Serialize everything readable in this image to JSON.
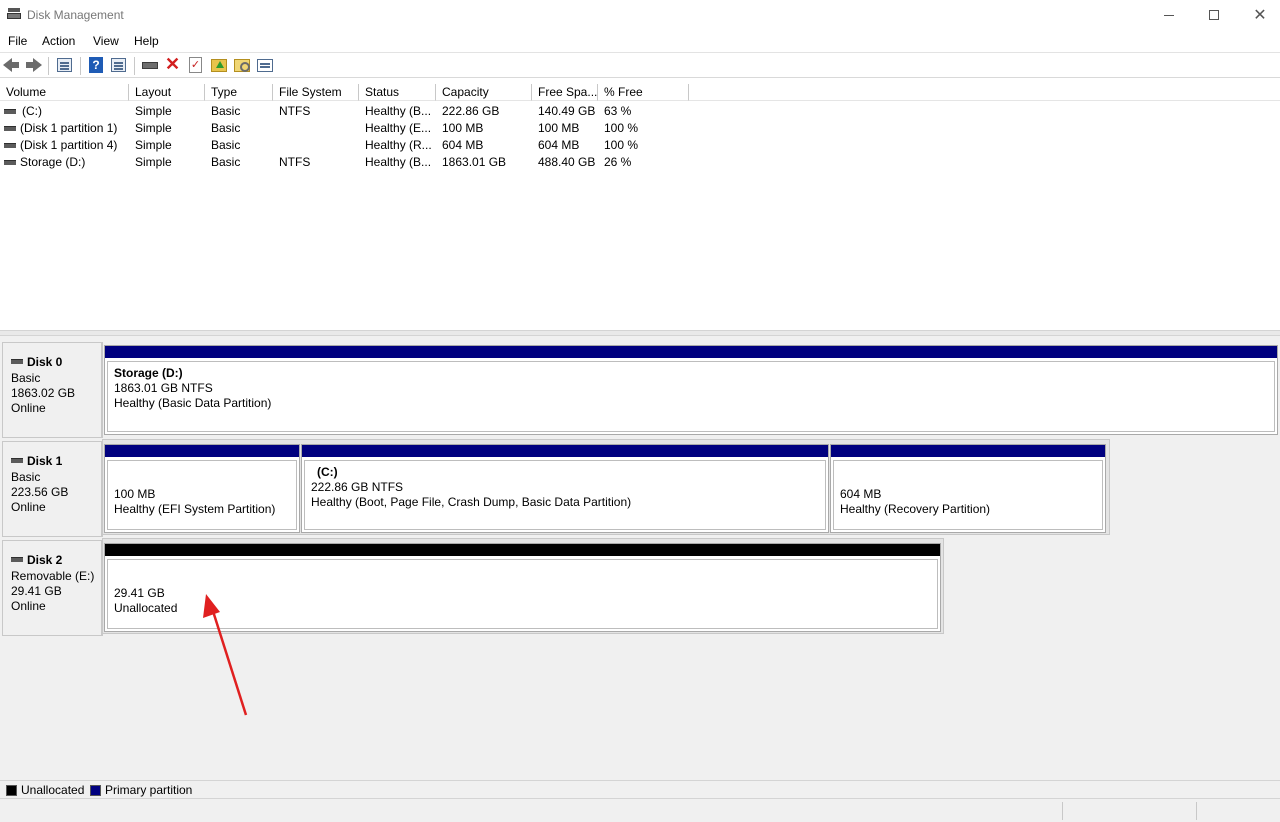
{
  "window": {
    "title": "Disk Management",
    "close_glyph": "✕"
  },
  "menu": [
    "File",
    "Action",
    "View",
    "Help"
  ],
  "toolbar": {
    "icons": [
      "back-icon",
      "forward-icon",
      "console-tree-icon",
      "help-icon",
      "show-action-pane-icon",
      "connect-disk-icon",
      "delete-icon",
      "check-properties-icon",
      "folder-up-icon",
      "folder-search-icon",
      "properties-icon"
    ],
    "help_glyph": "?",
    "x_glyph": "✕",
    "check_glyph": "✓"
  },
  "volume_table": {
    "columns": [
      "Volume",
      "Layout",
      "Type",
      "File System",
      "Status",
      "Capacity",
      "Free Spa...",
      "% Free"
    ],
    "rows": [
      {
        "volume": "(C:)",
        "layout": "Simple",
        "type": "Basic",
        "fs": "NTFS",
        "status": "Healthy (B...",
        "capacity": "222.86 GB",
        "free": "140.49 GB",
        "pct": "63 %"
      },
      {
        "volume": "(Disk 1 partition 1)",
        "layout": "Simple",
        "type": "Basic",
        "fs": "",
        "status": "Healthy (E...",
        "capacity": "100 MB",
        "free": "100 MB",
        "pct": "100 %"
      },
      {
        "volume": "(Disk 1 partition 4)",
        "layout": "Simple",
        "type": "Basic",
        "fs": "",
        "status": "Healthy (R...",
        "capacity": "604 MB",
        "free": "604 MB",
        "pct": "100 %"
      },
      {
        "volume": "Storage (D:)",
        "layout": "Simple",
        "type": "Basic",
        "fs": "NTFS",
        "status": "Healthy (B...",
        "capacity": "1863.01 GB",
        "free": "488.40 GB",
        "pct": "26 %"
      }
    ]
  },
  "disks": [
    {
      "name": "Disk 0",
      "type": "Basic",
      "size": "1863.02 GB",
      "state": "Online",
      "partitions": [
        {
          "title": "Storage  (D:)",
          "line1": "1863.01 GB NTFS",
          "line2": "Healthy (Basic Data Partition)"
        }
      ]
    },
    {
      "name": "Disk 1",
      "type": "Basic",
      "size": "223.56 GB",
      "state": "Online",
      "partitions": [
        {
          "line1": "100 MB",
          "line2": "Healthy (EFI System Partition)"
        },
        {
          "title": "(C:)",
          "line1": "222.86 GB NTFS",
          "line2": "Healthy (Boot, Page File, Crash Dump, Basic Data Partition)"
        },
        {
          "line1": "604 MB",
          "line2": "Healthy (Recovery Partition)"
        }
      ]
    },
    {
      "name": "Disk 2",
      "type": "Removable (E:)",
      "size": "29.41 GB",
      "state": "Online",
      "partitions": [
        {
          "line1": "29.41 GB",
          "line2": "Unallocated"
        }
      ]
    }
  ],
  "legend": [
    {
      "label": "Unallocated",
      "color": "#000000"
    },
    {
      "label": "Primary partition",
      "color": "#00007f"
    }
  ],
  "colors": {
    "primary": "#00007f",
    "unallocated": "#000000",
    "annotation": "#e02020"
  }
}
